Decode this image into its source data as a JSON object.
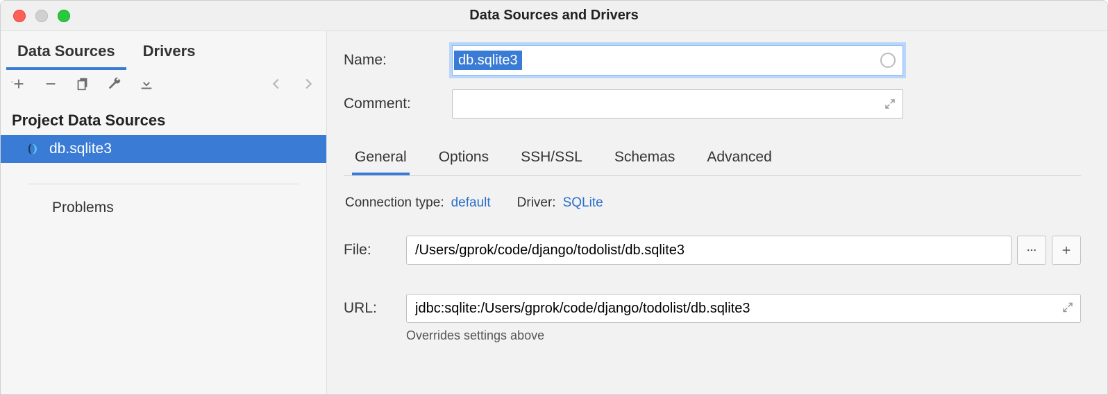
{
  "window": {
    "title": "Data Sources and Drivers"
  },
  "sidebar": {
    "tabs": [
      {
        "label": "Data Sources",
        "active": true
      },
      {
        "label": "Drivers",
        "active": false
      }
    ],
    "heading": "Project Data Sources",
    "items": [
      {
        "label": "db.sqlite3",
        "icon": "sqlite-icon",
        "selected": true
      }
    ],
    "subitems": [
      {
        "label": "Problems"
      }
    ]
  },
  "form": {
    "name_label": "Name:",
    "name_value": "db.sqlite3",
    "comment_label": "Comment:",
    "comment_value": ""
  },
  "main_tabs": [
    {
      "label": "General",
      "active": true
    },
    {
      "label": "Options",
      "active": false
    },
    {
      "label": "SSH/SSL",
      "active": false
    },
    {
      "label": "Schemas",
      "active": false
    },
    {
      "label": "Advanced",
      "active": false
    }
  ],
  "connection": {
    "type_label": "Connection type:",
    "type_value": "default",
    "driver_label": "Driver:",
    "driver_value": "SQLite"
  },
  "fields": {
    "file_label": "File:",
    "file_value": "/Users/gprok/code/django/todolist/db.sqlite3",
    "url_label": "URL:",
    "url_value": "jdbc:sqlite:/Users/gprok/code/django/todolist/db.sqlite3",
    "url_hint": "Overrides settings above"
  }
}
